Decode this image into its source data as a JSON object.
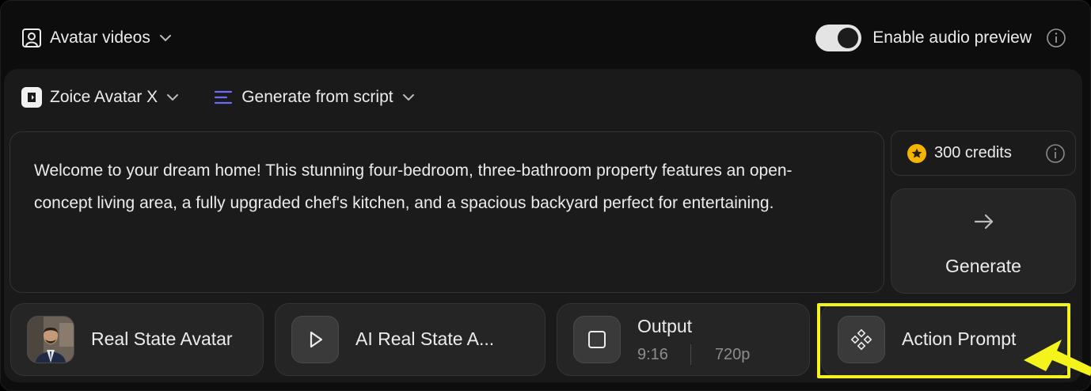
{
  "header": {
    "mode_label": "Avatar videos",
    "audio_preview_label": "Enable audio preview",
    "audio_preview_enabled": true
  },
  "selectors": {
    "model_label": "Zoice Avatar X",
    "source_label": "Generate from script"
  },
  "script": {
    "text": "Welcome to your dream home! This stunning four-bedroom, three-bathroom property features an open-concept living area, a fully upgraded chef's kitchen, and a spacious backyard perfect for entertaining."
  },
  "credits": {
    "value": "300 credits"
  },
  "generate": {
    "label": "Generate"
  },
  "cards": {
    "avatar": {
      "label": "Real State Avatar"
    },
    "voice": {
      "label": "AI Real State A..."
    },
    "output": {
      "label": "Output",
      "ratio": "9:16",
      "resolution": "720p"
    },
    "action": {
      "label": "Action Prompt"
    }
  },
  "colors": {
    "background": "#0d0d0d",
    "panel": "#1a1a1a",
    "accent_list_icon": "#6b6bf5",
    "credit_coin": "#f5b400",
    "highlight": "#f4f41c"
  }
}
